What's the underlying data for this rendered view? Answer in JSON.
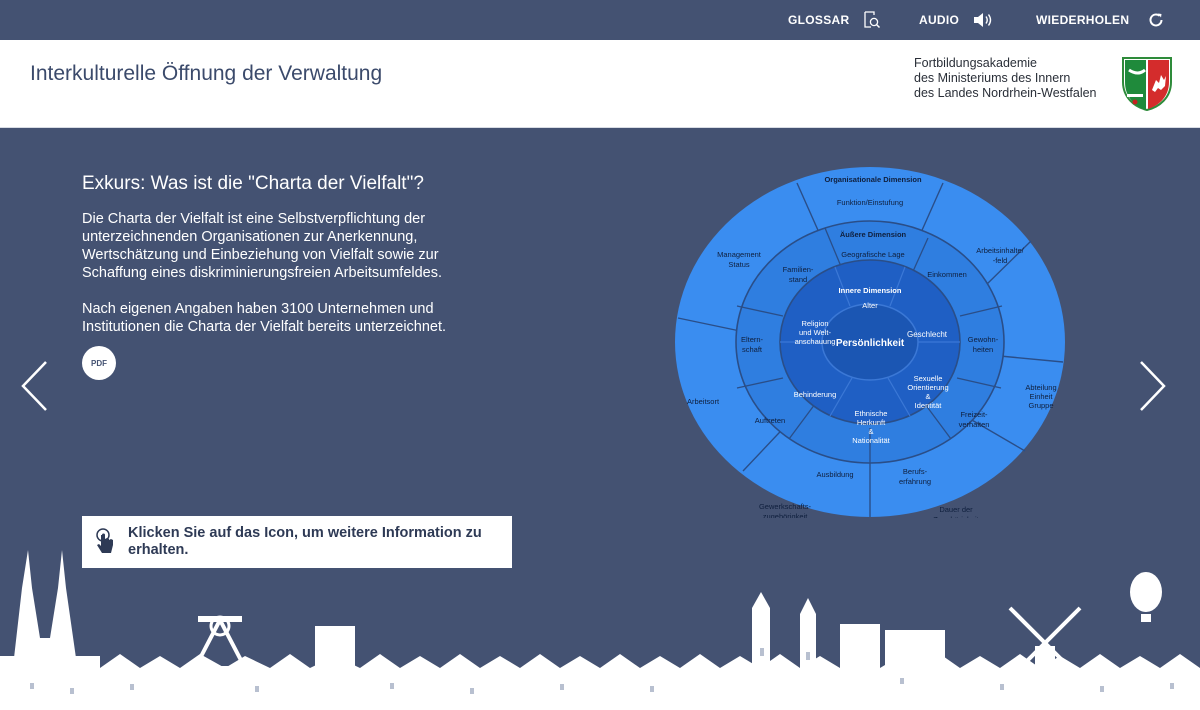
{
  "topbar": {
    "glossar_label": "GLOSSAR",
    "audio_label": "AUDIO",
    "wiederholen_label": "WIEDERHOLEN"
  },
  "header": {
    "title": "Interkulturelle Öffnung der Verwaltung",
    "org_line1": "Fortbildungsakademie",
    "org_line2": "des Ministeriums des Innern",
    "org_line3": "des Landes Nordrhein-Westfalen"
  },
  "content": {
    "heading": "Exkurs: Was ist die \"Charta der Vielfalt\"?",
    "paragraph1": "Die Charta der Vielfalt ist eine Selbstverpflichtung der unterzeichnenden Organisationen zur Anerkennung, Wertschätzung und Einbeziehung von Vielfalt sowie zur Schaffung eines diskriminierungsfreien Arbeitsumfeldes.",
    "paragraph2": "Nach eigenen Angaben haben 3100 Unternehmen und Institutionen die Charta der Vielfalt bereits unterzeichnet.",
    "pdf_label": "PDF",
    "hint": "Klicken Sie auf das Icon, um weitere Information zu erhalten."
  },
  "diagram": {
    "center": "Persönlichkeit",
    "inner_title": "Innere Dimension",
    "inner": [
      "Alter",
      "Geschlecht",
      "Sexuelle Orientierung & Identität",
      "Ethnische Herkunft & Nationalität",
      "Behinderung",
      "Religion und Welt-anschauung"
    ],
    "middle_title": "Äußere Dimension",
    "middle": [
      "Geografische Lage",
      "Einkommen",
      "Gewohn-heiten",
      "Freizeit-verhalten",
      "Berufs-erfahrung",
      "Ausbildung",
      "Auftreten",
      "Eltern-schaft",
      "Familien-stand"
    ],
    "outer_title": "Organisationale Dimension",
    "outer": [
      "Funktion/Einstufung",
      "Arbeitsinhalte/-feld",
      "Abteilung Einheit Gruppe",
      "Dauer der Zugehörigkeit",
      "Gewerkschafts-zugehörigkeit",
      "Arbeitsort",
      "Management Status"
    ]
  },
  "colors": {
    "background": "#445272",
    "outer_ring": "#3b8ef0",
    "middle_ring": "#2f7ee0",
    "inner_ring": "#1f5fc4",
    "center": "#1b56b3"
  }
}
